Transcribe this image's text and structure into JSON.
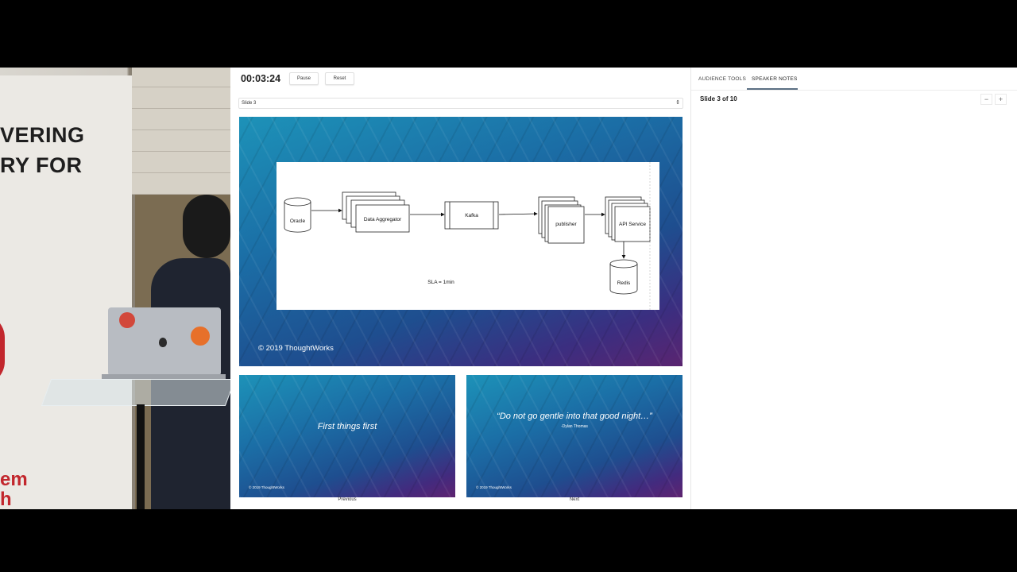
{
  "camera": {
    "banner_lines": [
      "VERING",
      "RY FOR"
    ],
    "banner_red_lines": [
      "em",
      "h"
    ]
  },
  "presenter": {
    "timer": "00:03:24",
    "pause_label": "Pause",
    "reset_label": "Reset",
    "slide_select": "Slide 3",
    "current_slide": {
      "copyright": "© 2019 ThoughtWorks",
      "diagram": {
        "oracle": "Oracle",
        "data_aggregator": "Data Aggregator",
        "kafka": "Kafka",
        "publisher": "publisher",
        "api_service": "API Service",
        "redis": "Redis",
        "sla": "SLA = 1min"
      }
    },
    "previous": {
      "title": "First things first",
      "copyright": "© 2019 ThoughtWorks",
      "label": "Previous"
    },
    "next": {
      "title": "“Do not go gentle into that good night…”",
      "subtitle": "-Dylan Thomas",
      "copyright": "© 2019 ThoughtWorks",
      "label": "Next"
    },
    "tabs": {
      "audience_tools": "AUDIENCE TOOLS",
      "speaker_notes": "SPEAKER NOTES"
    },
    "slide_count": "Slide 3 of 10",
    "zoom_out": "−",
    "zoom_in": "+",
    "colors": {
      "tab_underline": "#5b6f83",
      "slide_gradient_start": "#1d92b8",
      "slide_gradient_end": "#5a2470"
    }
  }
}
